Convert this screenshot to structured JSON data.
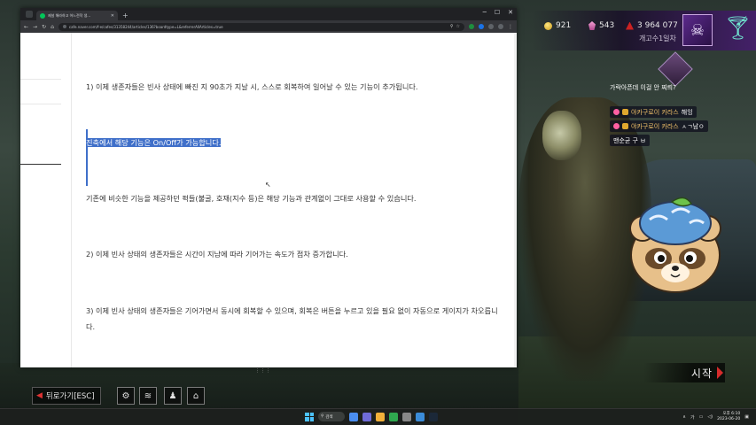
{
  "browser": {
    "tab_title": "제설 해라하고 어느전작 생...",
    "new_tab": "+",
    "url": "cafe.naver.com/f-e/cafes/31358244/articles/136?boardtype=L&referrerAllArticles=true",
    "window_controls": [
      "─",
      "☐",
      "✕"
    ]
  },
  "article": {
    "p1": "1) 이제 생존자들은 빈사 상태에 빠진 지 90초가 지날 시, 스스로 회복하여 일어날 수 있는 기능이 추가됩니다.",
    "p2": "진축에서 해당 기능은 On/Off가 가능합니다.",
    "p3": "기존에 비슷한 기능을 제공하던 퍽들(불굴, 호재(지수 등)은 해당 기능과 관계없이 그대로 사용할 수 있습니다.",
    "p4": "2) 이제 빈사 상태의 생존자들은 시간이 지남에 따라 기어가는 속도가 점차 증가합니다.",
    "p5": "3) 이제 빈사 상태의 생존자들은 기어가면서 동시에 회복할 수 있으며, 회복은 버튼을 누르고 있을 필요 없이 자동으로 게이지가 차오릅니다."
  },
  "hud": {
    "shards": "921",
    "cells": "543",
    "bloodpoints": "3 964 077",
    "rank_label": "개고수1일차"
  },
  "chat": {
    "top_line": "가락아픈데 이걸 안 찌릐?",
    "lines": [
      {
        "user": "야카구로이 카라스",
        "text": "해잉",
        "badge": "heart"
      },
      {
        "user": "야카구로이 카라스",
        "text": "ㅅㄱ남ㅇ",
        "badge": "heart"
      },
      {
        "user": "",
        "text": "맨순균 구 ㅂ",
        "badge": ""
      }
    ]
  },
  "game_ui": {
    "back_label": "뒤로가기[ESC]",
    "start_label": "시작",
    "icons": [
      "gear-icon",
      "stack-icon",
      "character-icon",
      "store-icon"
    ]
  },
  "taskbar": {
    "search_label": "검색",
    "time": "오후 6:10",
    "date": "2023-06-20"
  },
  "colors": {
    "selection": "#3f6fc9",
    "accent_purple": "#5b2a8c",
    "start_red": "#d62b2b"
  }
}
